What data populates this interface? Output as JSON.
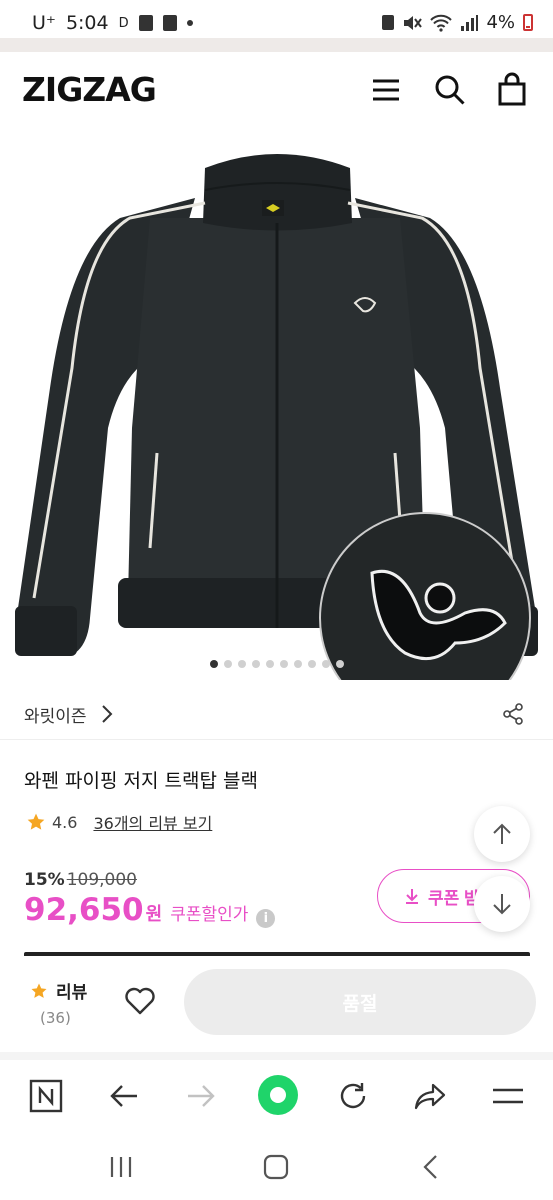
{
  "status_bar": {
    "carrier": "U⁺",
    "time": "5:04",
    "indicator": "D",
    "battery": "4%"
  },
  "header": {
    "logo": "ZIGZAG",
    "icons": [
      "menu-icon",
      "search-icon",
      "shopping-bag-icon"
    ]
  },
  "gallery": {
    "page_count": 10,
    "active_index": 0
  },
  "brand": {
    "name": "와릿이즌"
  },
  "product": {
    "title": "와펜 파이핑 저지 트랙탑 블랙",
    "rating": "4.6",
    "review_link": "36개의 리뷰 보기"
  },
  "price": {
    "discount_rate": "15%",
    "original": "109,000",
    "final": "92,650",
    "currency": "원",
    "coupon_price_label": "쿠폰할인가",
    "info_glyph": "i"
  },
  "coupon_button": {
    "label": "쿠폰 받"
  },
  "action_bar": {
    "review_label": "리뷰",
    "review_count": "(36)",
    "soldout_label": "품절"
  },
  "colors": {
    "accent_pink": "#e84fc6",
    "star": "#f5a623",
    "browser_home": "#1fd46a"
  }
}
